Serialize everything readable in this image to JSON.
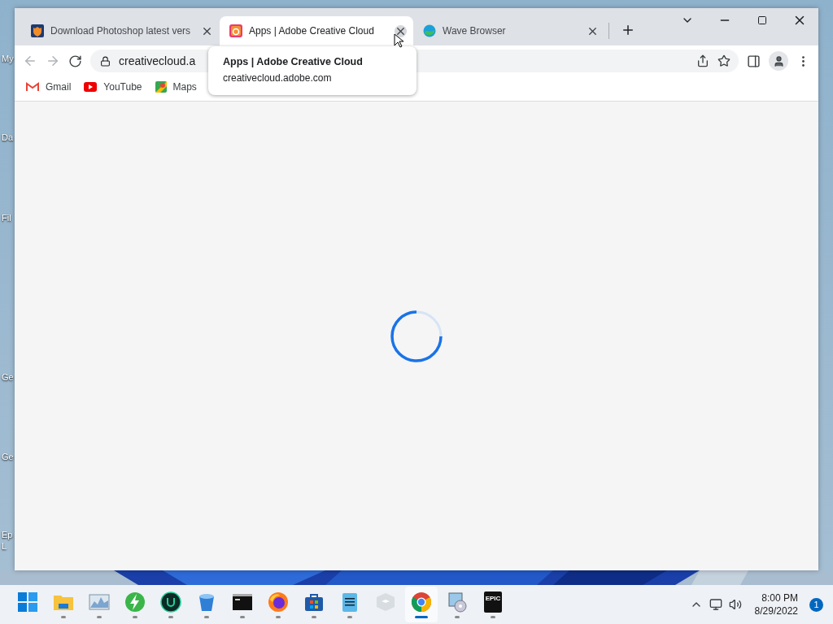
{
  "desktop_icons": [
    {
      "label": "My"
    },
    {
      "label": "Da"
    },
    {
      "label": "Fil"
    },
    {
      "label": "Ge"
    },
    {
      "label": "Ge"
    },
    {
      "label": "Ep"
    },
    {
      "label": "L"
    }
  ],
  "browser": {
    "tabs": [
      {
        "title": "Download Photoshop latest vers",
        "kind": "shield",
        "selected": false
      },
      {
        "title": "Apps | Adobe Creative Cloud",
        "kind": "creative-cloud",
        "selected": true
      },
      {
        "title": "Wave Browser",
        "kind": "wave",
        "selected": false
      }
    ],
    "address": "creativecloud.a",
    "bookmarks": [
      {
        "label": "Gmail",
        "kind": "gmail"
      },
      {
        "label": "YouTube",
        "kind": "youtube"
      },
      {
        "label": "Maps",
        "kind": "maps"
      }
    ],
    "tooltip": {
      "title": "Apps | Adobe Creative Cloud",
      "url": "creativecloud.adobe.com"
    }
  },
  "taskbar": {
    "apps": [
      {
        "kind": "start",
        "running": false,
        "selected": false
      },
      {
        "kind": "folder",
        "running": true,
        "selected": false
      },
      {
        "kind": "monitor",
        "running": true,
        "selected": false
      },
      {
        "kind": "bolt",
        "running": true,
        "selected": false
      },
      {
        "kind": "u-circle",
        "running": true,
        "selected": false
      },
      {
        "kind": "bucket",
        "running": true,
        "selected": false
      },
      {
        "kind": "terminal",
        "running": true,
        "selected": false
      },
      {
        "kind": "firefox",
        "running": true,
        "selected": false
      },
      {
        "kind": "store",
        "running": true,
        "selected": false
      },
      {
        "kind": "notepad",
        "running": true,
        "selected": false
      },
      {
        "kind": "cube",
        "running": false,
        "selected": false
      },
      {
        "kind": "chrome",
        "running": true,
        "selected": true
      },
      {
        "kind": "installer",
        "running": true,
        "selected": false
      },
      {
        "kind": "epic",
        "running": true,
        "selected": false,
        "label": "EPIC"
      }
    ],
    "time": "8:00 PM",
    "date": "8/29/2022",
    "notifications": "1"
  }
}
